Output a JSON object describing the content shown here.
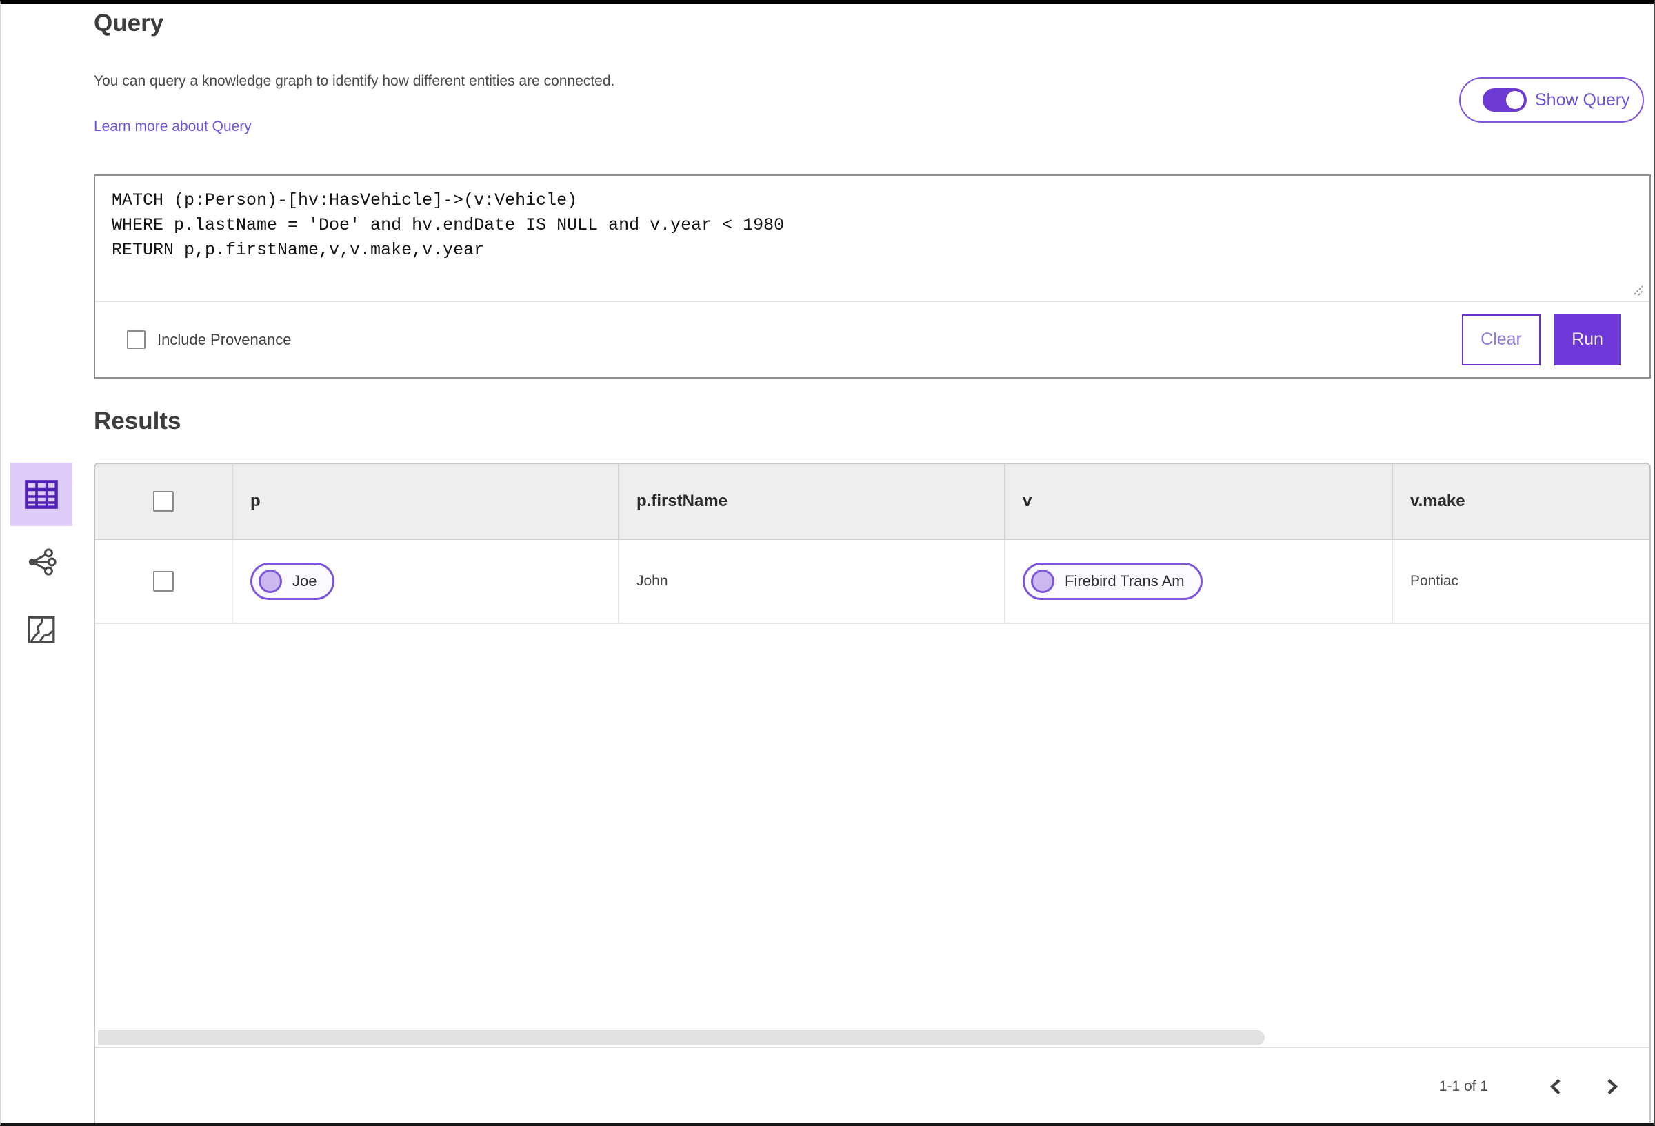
{
  "header": {
    "title": "Query",
    "description": "You can query a knowledge graph to identify how different entities are connected.",
    "learn_more_link": "Learn more about Query",
    "show_query_toggle": {
      "label": "Show Query",
      "state": "on"
    }
  },
  "query_editor": {
    "code": "MATCH (p:Person)-[hv:HasVehicle]->(v:Vehicle)\nWHERE p.lastName = 'Doe' and hv.endDate IS NULL and v.year < 1980\nRETURN p,p.firstName,v,v.make,v.year",
    "include_provenance": {
      "label": "Include Provenance",
      "checked": false
    },
    "buttons": {
      "clear": "Clear",
      "run": "Run"
    }
  },
  "results": {
    "heading": "Results",
    "view_switcher": [
      {
        "icon": "table-view-icon",
        "selected": true
      },
      {
        "icon": "network-view-icon",
        "selected": false
      },
      {
        "icon": "map-view-icon",
        "selected": false
      }
    ],
    "table": {
      "columns": [
        "p",
        "p.firstName",
        "v",
        "v.make"
      ],
      "rows": [
        {
          "p_entity": "Joe",
          "p_firstName": "John",
          "v_entity": "Firebird Trans Am",
          "v_make": "Pontiac"
        }
      ]
    },
    "pagination": {
      "range": "1-1 of 1"
    }
  },
  "colors": {
    "accent_purple": "#6e37d8",
    "link_purple": "#6a58d5",
    "toggle_purple": "#6e3ad4",
    "entity_pill_border": "#7e57d9",
    "entity_pill_dot": "#cbb9f0",
    "selected_view_bg": "#ddccf7",
    "table_header_bg": "#eeeeee"
  }
}
